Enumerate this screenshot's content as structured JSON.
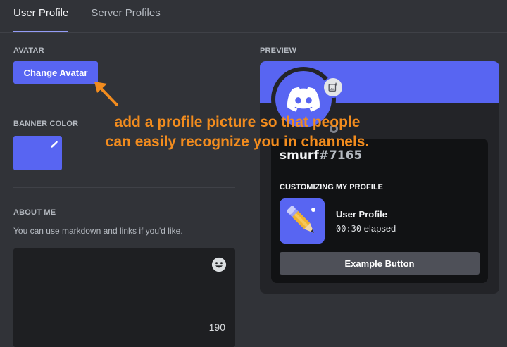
{
  "tabs": [
    {
      "label": "User Profile",
      "active": true
    },
    {
      "label": "Server Profiles",
      "active": false
    }
  ],
  "avatar_section": {
    "label": "AVATAR",
    "button_label": "Change Avatar"
  },
  "banner_section": {
    "label": "BANNER COLOR",
    "color": "#5865f2",
    "edit_icon": "pencil-icon"
  },
  "about_section": {
    "label": "ABOUT ME",
    "hint": "You can use markdown and links if you'd like.",
    "value": "",
    "char_remaining": "190",
    "emoji_icon": "smiley-icon"
  },
  "preview": {
    "label": "PREVIEW",
    "banner_color": "#5865f2",
    "username": "smurf",
    "discriminator": "#7165",
    "section_title": "CUSTOMIZING MY PROFILE",
    "activity_title": "User Profile",
    "elapsed_time": "00:30",
    "elapsed_suffix": " elapsed",
    "button_label": "Example Button"
  },
  "annotation": {
    "line1": "add a profile picture so that people",
    "line2": "can easily recognize you in channels.",
    "color": "#f28c1e"
  }
}
